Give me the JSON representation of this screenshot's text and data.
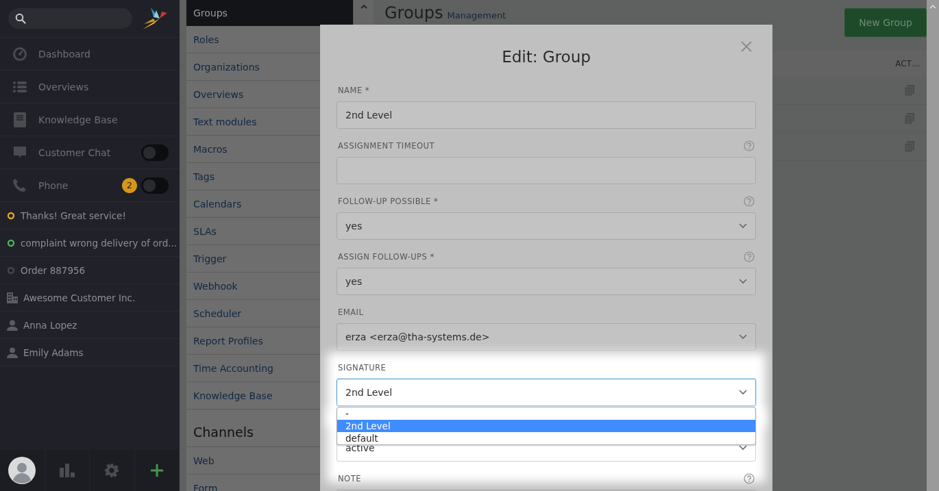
{
  "sidebar": {
    "nav": [
      {
        "kind": "link",
        "label": "Dashboard"
      },
      {
        "kind": "link",
        "label": "Overviews"
      },
      {
        "kind": "link",
        "label": "Knowledge Base"
      },
      {
        "kind": "toggle",
        "label": "Customer Chat",
        "on": false
      },
      {
        "kind": "toggle",
        "label": "Phone",
        "on": false,
        "badge": "2"
      }
    ],
    "recent": [
      {
        "kind": "ticket",
        "color": "#e0a324",
        "label": "Thanks! Great service!"
      },
      {
        "kind": "ticket",
        "color": "#4cae5a",
        "label": "complaint wrong delivery of ord..."
      },
      {
        "kind": "ticket",
        "color": "#44464c",
        "label": "Order 887956"
      },
      {
        "kind": "organization",
        "label": "Awesome Customer Inc."
      },
      {
        "kind": "user",
        "label": "Anna Lopez"
      },
      {
        "kind": "user",
        "label": "Emily Adams"
      }
    ]
  },
  "settings_nav": [
    {
      "items": [
        {
          "label": "Groups",
          "selected": true
        },
        {
          "label": "Roles",
          "selected": false
        },
        {
          "label": "Organizations",
          "selected": false
        },
        {
          "label": "Overviews",
          "selected": false
        },
        {
          "label": "Text modules",
          "selected": false
        },
        {
          "label": "Macros",
          "selected": false
        },
        {
          "label": "Tags",
          "selected": false
        },
        {
          "label": "Calendars",
          "selected": false
        },
        {
          "label": "SLAs",
          "selected": false
        },
        {
          "label": "Trigger",
          "selected": false
        },
        {
          "label": "Webhook",
          "selected": false
        },
        {
          "label": "Scheduler",
          "selected": false
        },
        {
          "label": "Report Profiles",
          "selected": false
        },
        {
          "label": "Time Accounting",
          "selected": false
        },
        {
          "label": "Knowledge Base",
          "selected": false
        }
      ]
    },
    {
      "heading": "Channels",
      "items": [
        {
          "label": "Web",
          "selected": false
        },
        {
          "label": "Form",
          "selected": false
        }
      ]
    }
  ],
  "page": {
    "title": "Groups",
    "subtitle": "Management",
    "new_button": "New Group",
    "table": {
      "columns": [
        "ACT…"
      ],
      "rows": [
        {
          "kind": "clone"
        },
        {
          "kind": "clone"
        },
        {
          "kind": "clone"
        }
      ]
    }
  },
  "modal": {
    "title": "Edit: Group",
    "fields": [
      {
        "kind": "text",
        "label": "NAME *",
        "help": false,
        "value": "2nd Level",
        "highlighted": false
      },
      {
        "kind": "text",
        "label": "ASSIGNMENT TIMEOUT",
        "help": true,
        "highlighted": false
      },
      {
        "kind": "select",
        "label": "FOLLOW-UP POSSIBLE *",
        "help": true,
        "value": "yes",
        "highlighted": false
      },
      {
        "kind": "select",
        "label": "ASSIGN FOLLOW-UPS *",
        "help": true,
        "value": "yes",
        "highlighted": false
      },
      {
        "kind": "select",
        "label": "EMAIL",
        "help": false,
        "value": "erza <erza@tha-systems.de>",
        "highlighted": false
      },
      {
        "kind": "select",
        "label": "SIGNATURE",
        "help": false,
        "value": "2nd Level",
        "highlighted": true,
        "focused": true,
        "options": [
          {
            "label": "-",
            "selected": false
          },
          {
            "label": "2nd Level",
            "selected": true
          },
          {
            "label": "default",
            "selected": false
          }
        ]
      },
      {
        "kind": "select",
        "value": "active",
        "help": false,
        "highlighted": true
      },
      {
        "kind": "textarea",
        "label": "NOTE",
        "help": true,
        "highlighted": false
      }
    ]
  }
}
